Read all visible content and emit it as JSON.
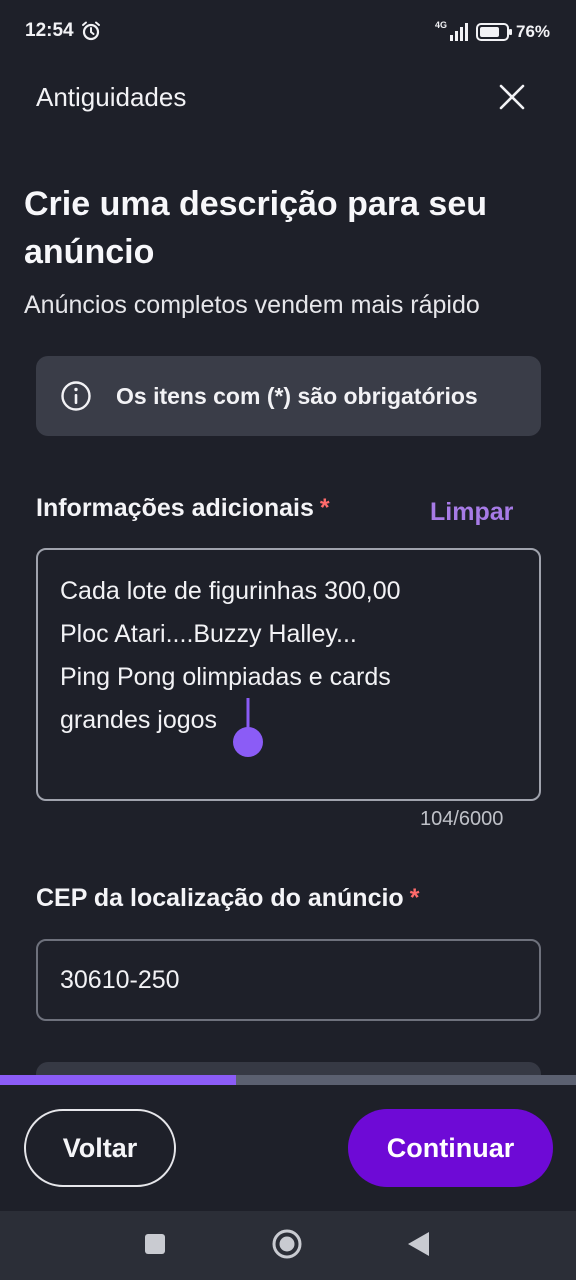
{
  "status_bar": {
    "time": "12:54",
    "network": "4G",
    "battery": "76%"
  },
  "header": {
    "title": "Antiguidades",
    "close_icon": "close-icon"
  },
  "page": {
    "title": "Crie uma descrição para seu anúncio",
    "subtitle": "Anúncios completos vendem mais rápido"
  },
  "info": {
    "icon": "info-icon",
    "text": "Os itens com (*) são obrigatórios"
  },
  "additional_info": {
    "label": "Informações adicionais",
    "required_mark": "*",
    "clear_label": "Limpar",
    "lines": [
      "Cada lote de figurinhas 300,00",
      "Ploc Atari....Buzzy Halley...",
      "Ping Pong olimpiadas e cards",
      "grandes jogos"
    ],
    "counter": "104/6000"
  },
  "cep": {
    "label": "CEP da localização do anúncio",
    "required_mark": "*",
    "value": "30610-250"
  },
  "progress": {
    "fraction": 0.41
  },
  "actions": {
    "back_label": "Voltar",
    "continue_label": "Continuar"
  },
  "colors": {
    "background": "#1e2029",
    "accent": "#6e0ad6",
    "link": "#a77be6",
    "required": "#ff6b6b",
    "progress": "#8b5cf6"
  }
}
